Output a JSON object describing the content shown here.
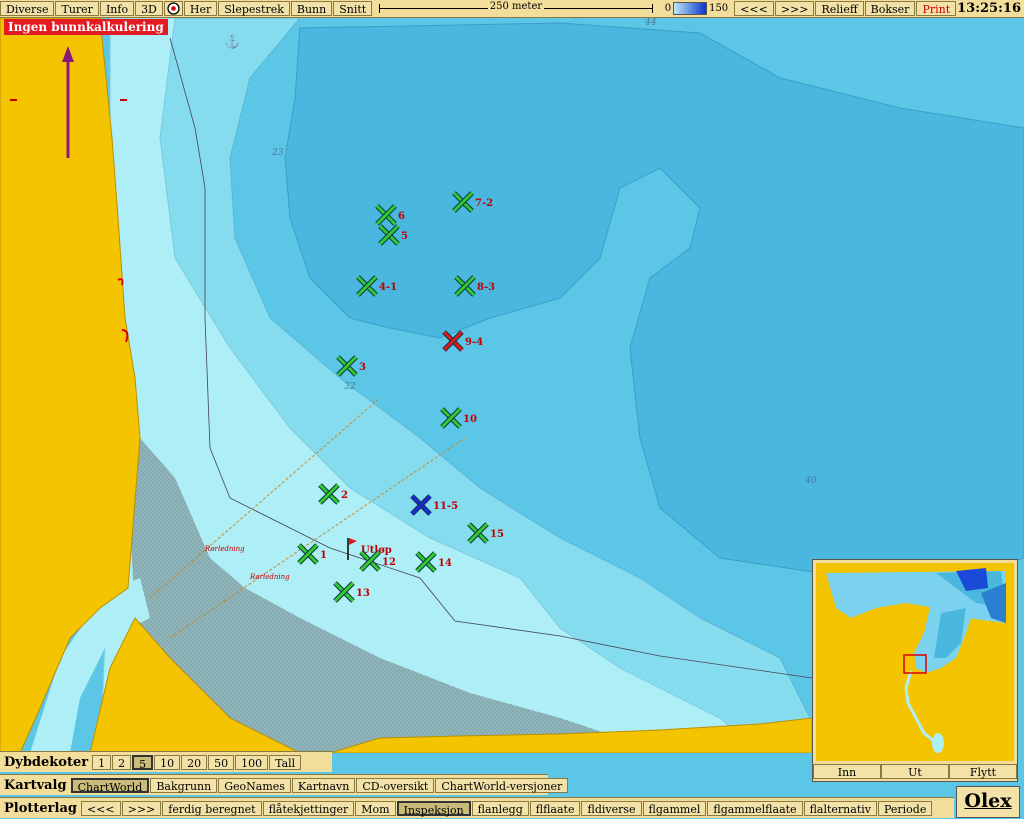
{
  "toolbar": {
    "buttons": [
      "Diverse",
      "Turer",
      "Info",
      "3D",
      "Her",
      "Slepestrek",
      "Bunn",
      "Snitt"
    ],
    "scale_label": "250 meter",
    "depth_min": "0",
    "depth_max": "150",
    "nav_back": "<<<",
    "nav_fwd": ">>>",
    "relief": "Relieff",
    "bokser": "Bokser",
    "print": "Print",
    "clock": "13:25:16"
  },
  "warning": "Ingen bunnkalkulering",
  "map": {
    "depth_labels": [
      "44",
      "23",
      "32",
      "40"
    ],
    "pipeline_label": "Rørledning",
    "outlet_label": "Utløp",
    "markers": [
      {
        "label": "6",
        "color": "green"
      },
      {
        "label": "5",
        "color": "green"
      },
      {
        "label": "7-2",
        "color": "green"
      },
      {
        "label": "4-1",
        "color": "green"
      },
      {
        "label": "8-3",
        "color": "green"
      },
      {
        "label": "9-4",
        "color": "red"
      },
      {
        "label": "3",
        "color": "green"
      },
      {
        "label": "10",
        "color": "green"
      },
      {
        "label": "2",
        "color": "green"
      },
      {
        "label": "11-5",
        "color": "blue"
      },
      {
        "label": "15",
        "color": "green"
      },
      {
        "label": "1",
        "color": "green"
      },
      {
        "label": "12",
        "color": "green"
      },
      {
        "label": "14",
        "color": "green"
      },
      {
        "label": "13",
        "color": "green"
      }
    ]
  },
  "inset": {
    "buttons": [
      "Inn",
      "Ut",
      "Flytt"
    ]
  },
  "dybdekoter": {
    "title": "Dybdekoter",
    "options": [
      "1",
      "2",
      "5",
      "10",
      "20",
      "50",
      "100",
      "Tall"
    ],
    "selected": "5"
  },
  "kartvalg": {
    "title": "Kartvalg",
    "options": [
      "ChartWorld",
      "Bakgrunn",
      "GeoNames",
      "Kartnavn",
      "CD-oversikt",
      "ChartWorld-versjoner"
    ],
    "selected": "ChartWorld"
  },
  "plotterlag": {
    "title": "Plotterlag",
    "options": [
      "<<<",
      ">>>",
      "ferdig beregnet",
      "flåtekjettinger",
      "Mom",
      "Inspeksjon",
      "flanlegg",
      "flflaate",
      "fldiverse",
      "flgammel",
      "flgammelflaate",
      "flalternativ",
      "Periode"
    ],
    "selected": "Inspeksjon"
  },
  "brand": "Olex",
  "colors": {
    "land": "#f5c400",
    "shallow": "#aeeef6",
    "mid": "#86dcef",
    "deep": "#5cc6e6",
    "deeper": "#4ab7df",
    "marker_green": "#2ecc2e",
    "marker_red": "#e01b1b",
    "marker_blue": "#1a2ad8",
    "label_red": "#c00000"
  }
}
